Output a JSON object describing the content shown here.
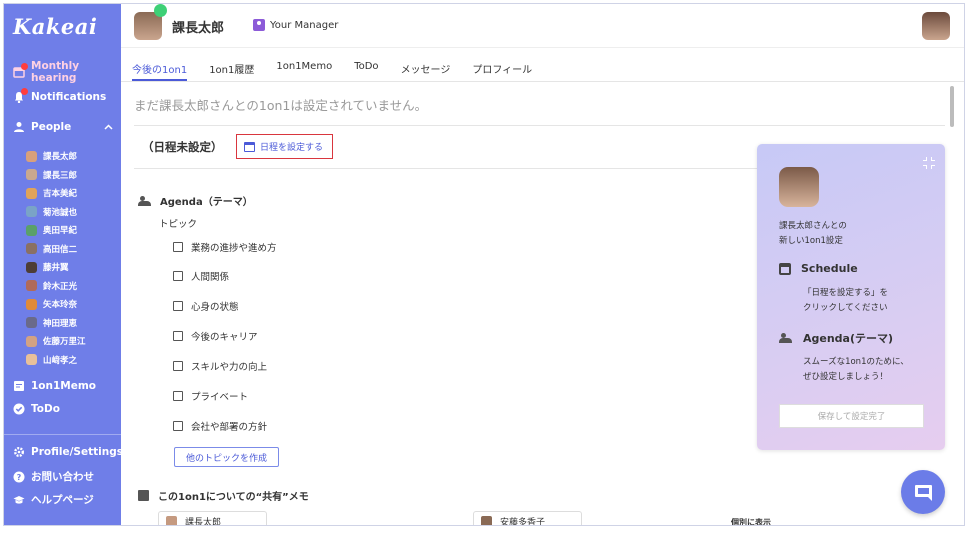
{
  "app": {
    "logo": "Kakeai"
  },
  "sidebar": {
    "items": [
      {
        "label": "Monthly hearing",
        "icon": "calendar-icon"
      },
      {
        "label": "Notifications",
        "icon": "bell-icon"
      },
      {
        "label": "People",
        "icon": "person-icon"
      }
    ],
    "people": [
      "課長太郎",
      "課長三郎",
      "吉本美紀",
      "菊池誠也",
      "奥田早紀",
      "高田信二",
      "藤井翼",
      "鈴木正光",
      "矢本玲奈",
      "神田理恵",
      "佐藤万里江",
      "山﨑孝之"
    ],
    "bottom_items": [
      {
        "label": "1on1Memo",
        "icon": "memo-icon"
      },
      {
        "label": "ToDo",
        "icon": "check-icon"
      }
    ],
    "footer_items": [
      {
        "label": "Profile/Settings",
        "icon": "gear-icon"
      },
      {
        "label": "お問い合わせ",
        "icon": "help-icon"
      },
      {
        "label": "ヘルプページ",
        "icon": "graduation-icon"
      }
    ]
  },
  "header": {
    "name": "課長太郎",
    "role": "Your Manager"
  },
  "tabs": [
    "今後の1on1",
    "1on1履歴",
    "1on1Memo",
    "ToDo",
    "メッセージ",
    "プロフィール"
  ],
  "main": {
    "notice": "まだ課長太郎さんとの1on1は設定されていません。",
    "unset_label": "（日程未設定）",
    "schedule_button": "日程を設定する",
    "agenda_title": "Agenda（テーマ）",
    "topic_label": "トピック",
    "topics": [
      "業務の進捗や進め方",
      "人間関係",
      "心身の状態",
      "今後のキャリア",
      "スキルや力の向上",
      "プライベート",
      "会社や部署の方針"
    ],
    "add_topic": "他のトピックを作成",
    "memo_title": "この1on1についての“共有”メモ",
    "memo_owner_a": "課長太郎",
    "memo_owner_b": "安藤多香子",
    "individual_label": "個別に表示"
  },
  "guide": {
    "intro_line1": "課長太郎さんとの",
    "intro_line2": "新しい1on1設定",
    "schedule_title": "Schedule",
    "schedule_line1": "「日程を設定する」を",
    "schedule_line2": "クリックしてください",
    "agenda_title": "Agenda(テーマ)",
    "agenda_line1": "スムーズな1on1のために、",
    "agenda_line2": "ぜひ設定しましょう！",
    "save_button": "保存して設定完了"
  },
  "colors": {
    "sidebar": "#6f7ee8",
    "accent": "#4b5ad8",
    "highlight_border": "#d9363e",
    "online": "#3ed076"
  }
}
